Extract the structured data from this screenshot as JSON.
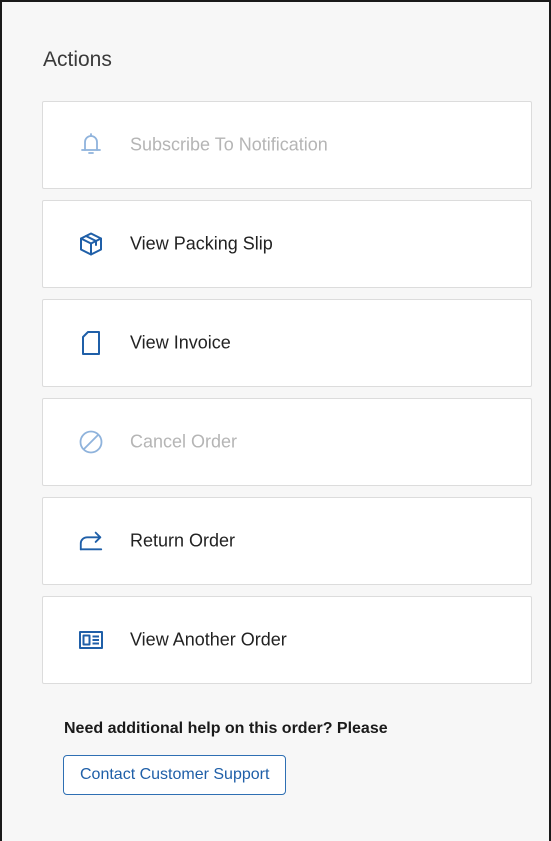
{
  "panel": {
    "title": "Actions"
  },
  "actions": [
    {
      "label": "Subscribe To Notification",
      "icon": "bell-icon",
      "state": "disabled"
    },
    {
      "label": "View Packing Slip",
      "icon": "package-icon",
      "state": "enabled"
    },
    {
      "label": "View Invoice",
      "icon": "document-icon",
      "state": "enabled"
    },
    {
      "label": "Cancel Order",
      "icon": "cancel-icon",
      "state": "disabled"
    },
    {
      "label": "Return Order",
      "icon": "return-arrow-icon",
      "state": "enabled"
    },
    {
      "label": "View Another Order",
      "icon": "order-card-icon",
      "state": "enabled"
    }
  ],
  "help": {
    "text": "Need additional help on this order? Please",
    "support_button": "Contact Customer Support"
  },
  "colors": {
    "accent": "#1f5fa8",
    "disabled": "#b5b5b5",
    "text": "#222222",
    "panel_bg": "#f7f7f7",
    "card_border": "#dcdcdc"
  }
}
